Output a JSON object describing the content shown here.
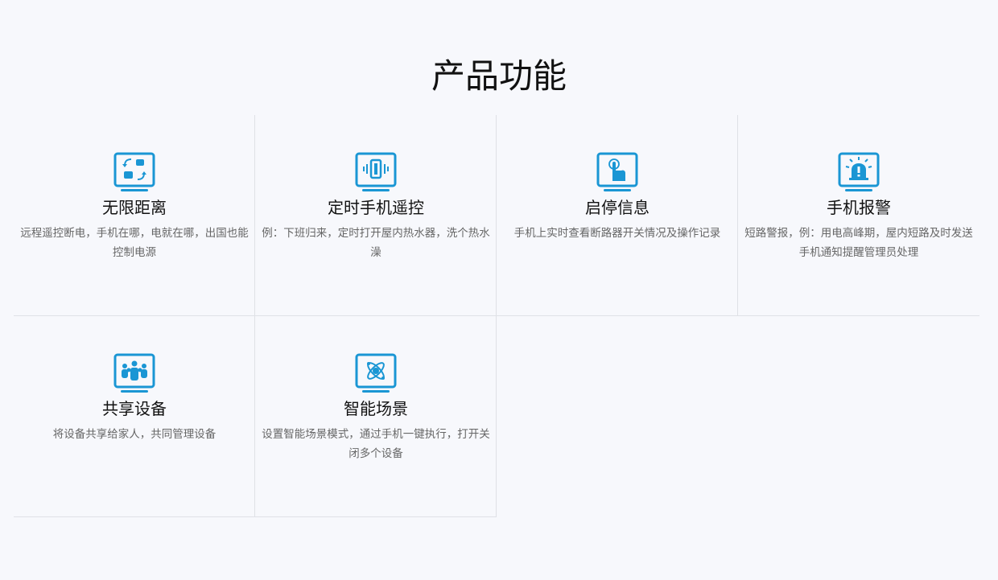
{
  "section": {
    "title": "产品功能"
  },
  "colors": {
    "icon_blue": "#1a96d4",
    "divider": "#dfe1e6",
    "background": "#f7f8fc"
  },
  "features": [
    {
      "icon": "remote-control-icon",
      "title": "无限距离",
      "desc": "远程遥控断电，手机在哪，电就在哪，出国也能控制电源"
    },
    {
      "icon": "phone-vibrate-icon",
      "title": "定时手机遥控",
      "desc": "例：下班归来，定时打开屋内热水器，洗个热水澡"
    },
    {
      "icon": "touch-hand-icon",
      "title": "启停信息",
      "desc": "手机上实时查看断路器开关情况及操作记录"
    },
    {
      "icon": "alarm-siren-icon",
      "title": "手机报警",
      "desc": "短路警报，例：用电高峰期，屋内短路及时发送手机通知提醒管理员处理"
    },
    {
      "icon": "share-users-icon",
      "title": "共享设备",
      "desc": "将设备共享给家人，共同管理设备"
    },
    {
      "icon": "smart-scene-atom-icon",
      "title": "智能场景",
      "desc": "设置智能场景模式，通过手机一键执行，打开关闭多个设备"
    }
  ]
}
